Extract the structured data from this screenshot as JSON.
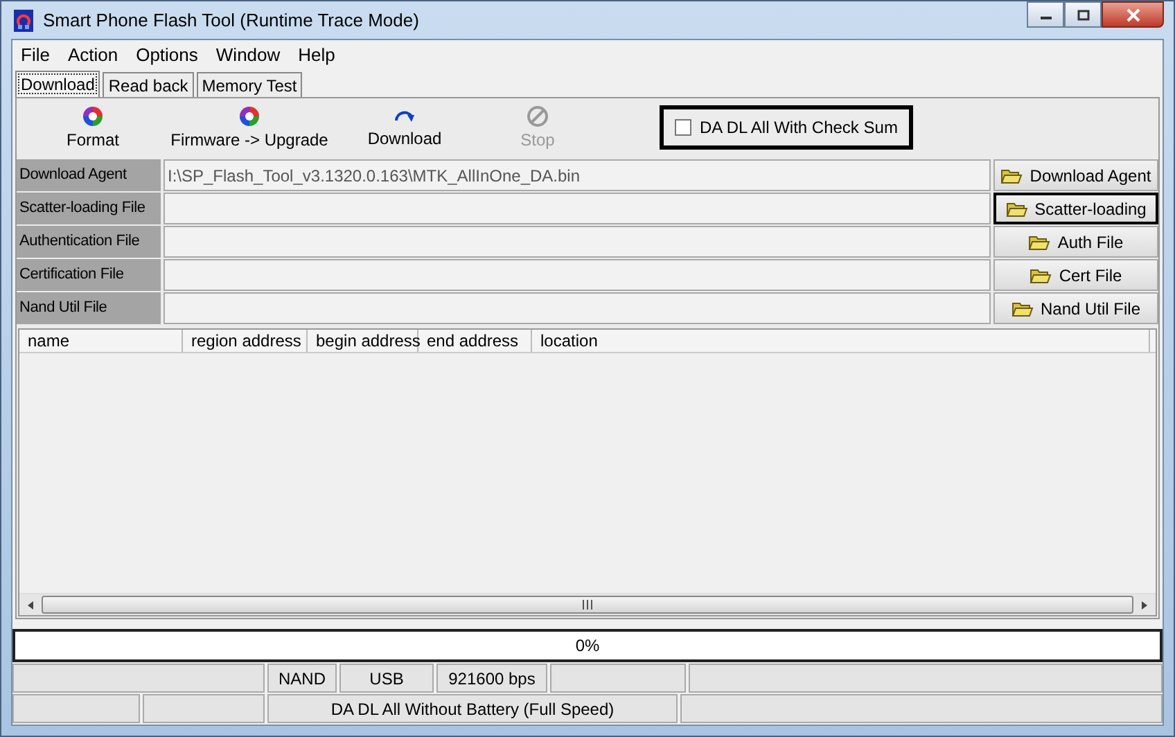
{
  "window": {
    "title": "Smart Phone Flash Tool (Runtime Trace Mode)"
  },
  "menu": [
    "File",
    "Action",
    "Options",
    "Window",
    "Help"
  ],
  "tabs": [
    {
      "label": "Download",
      "selected": true
    },
    {
      "label": "Read back",
      "selected": false
    },
    {
      "label": "Memory Test",
      "selected": false
    }
  ],
  "toolbar": [
    {
      "label": "Format",
      "kind": "format",
      "disabled": false
    },
    {
      "label": "Firmware -> Upgrade",
      "kind": "firmware",
      "disabled": false
    },
    {
      "label": "Download",
      "kind": "download",
      "disabled": false
    },
    {
      "label": "Stop",
      "kind": "stop",
      "disabled": true
    }
  ],
  "checksum": {
    "label": "DA DL All With Check Sum",
    "checked": false
  },
  "files": [
    {
      "label": "Download Agent",
      "value": "I:\\SP_Flash_Tool_v3.1320.0.163\\MTK_AllInOne_DA.bin",
      "button": "Download Agent",
      "focused": false
    },
    {
      "label": "Scatter-loading File",
      "button": "Scatter-loading",
      "focused": true
    },
    {
      "label": "Authentication File",
      "button": "Auth File",
      "focused": false
    },
    {
      "label": "Certification File",
      "button": "Cert File",
      "focused": false
    },
    {
      "label": "Nand Util File",
      "button": "Nand Util File",
      "focused": false
    }
  ],
  "table": {
    "columns": [
      "name",
      "region address",
      "begin address",
      "end address",
      "location"
    ]
  },
  "progress": {
    "text": "0%",
    "level": 0
  },
  "status_bar": {
    "row_1": [
      "NAND",
      "USB",
      "921600 bps"
    ],
    "row_2": [
      "DA DL All Without Battery (Full Speed)"
    ]
  }
}
